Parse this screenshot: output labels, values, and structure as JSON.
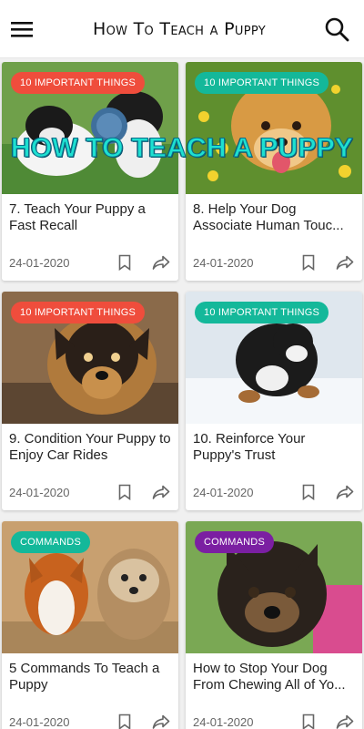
{
  "header": {
    "title": "How To Teach a Puppy",
    "menu_icon": "hamburger-menu-icon",
    "search_icon": "search-icon"
  },
  "overlay": {
    "text": "HOW TO TEACH A PUPPY"
  },
  "colors": {
    "teal_badge": "#14b89a",
    "red_badge": "#ef4d3c",
    "purple_badge": "#7b1fa2"
  },
  "cards": [
    {
      "badge": "10 IMPORTANT THINGS",
      "title": "7. Teach Your Puppy a Fast Recall",
      "date": "24-01-2020"
    },
    {
      "badge": "10 IMPORTANT THINGS",
      "title": "8. Help Your Dog Associate Human Touc...",
      "date": "24-01-2020"
    },
    {
      "badge": "10 IMPORTANT THINGS",
      "title": "9. Condition Your Puppy to Enjoy Car Rides",
      "date": "24-01-2020"
    },
    {
      "badge": "10 IMPORTANT THINGS",
      "title": "10. Reinforce Your Puppy's Trust",
      "date": "24-01-2020"
    },
    {
      "badge": "COMMANDS",
      "title": "5 Commands To Teach a Puppy",
      "date": "24-01-2020"
    },
    {
      "badge": "COMMANDS",
      "title": "How to Stop Your Dog From Chewing All of Yo...",
      "date": "24-01-2020"
    }
  ],
  "card_actions": {
    "bookmark_icon": "bookmark-icon",
    "share_icon": "share-icon"
  }
}
